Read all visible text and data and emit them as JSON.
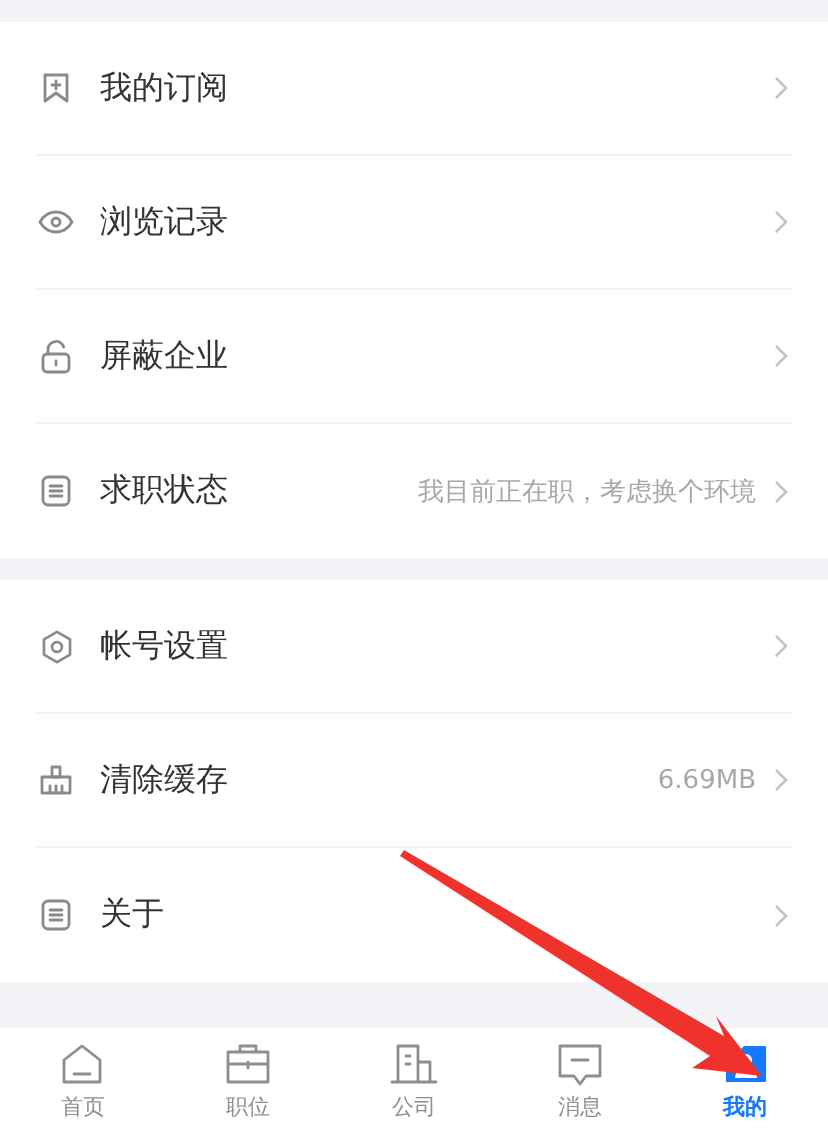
{
  "menu_groups": [
    {
      "items": [
        {
          "kind": "bookmark",
          "label": "我的订阅"
        },
        {
          "kind": "eye",
          "label": "浏览记录"
        },
        {
          "kind": "lock",
          "label": "屏蔽企业"
        },
        {
          "kind": "list",
          "label": "求职状态",
          "value": "我目前正在职，考虑换个环境"
        }
      ]
    },
    {
      "items": [
        {
          "kind": "gear",
          "label": "帐号设置"
        },
        {
          "kind": "broom",
          "label": "清除缓存",
          "value": "6.69MB"
        },
        {
          "kind": "list",
          "label": "关于"
        }
      ]
    }
  ],
  "tab_bar": [
    {
      "kind": "home",
      "label": "首页",
      "selected": false
    },
    {
      "kind": "briefcase",
      "label": "职位",
      "selected": false
    },
    {
      "kind": "building",
      "label": "公司",
      "selected": false
    },
    {
      "kind": "message",
      "label": "消息",
      "selected": false
    },
    {
      "kind": "person",
      "label": "我的",
      "selected": true
    }
  ],
  "annotation": {
    "kind": "arrow"
  }
}
